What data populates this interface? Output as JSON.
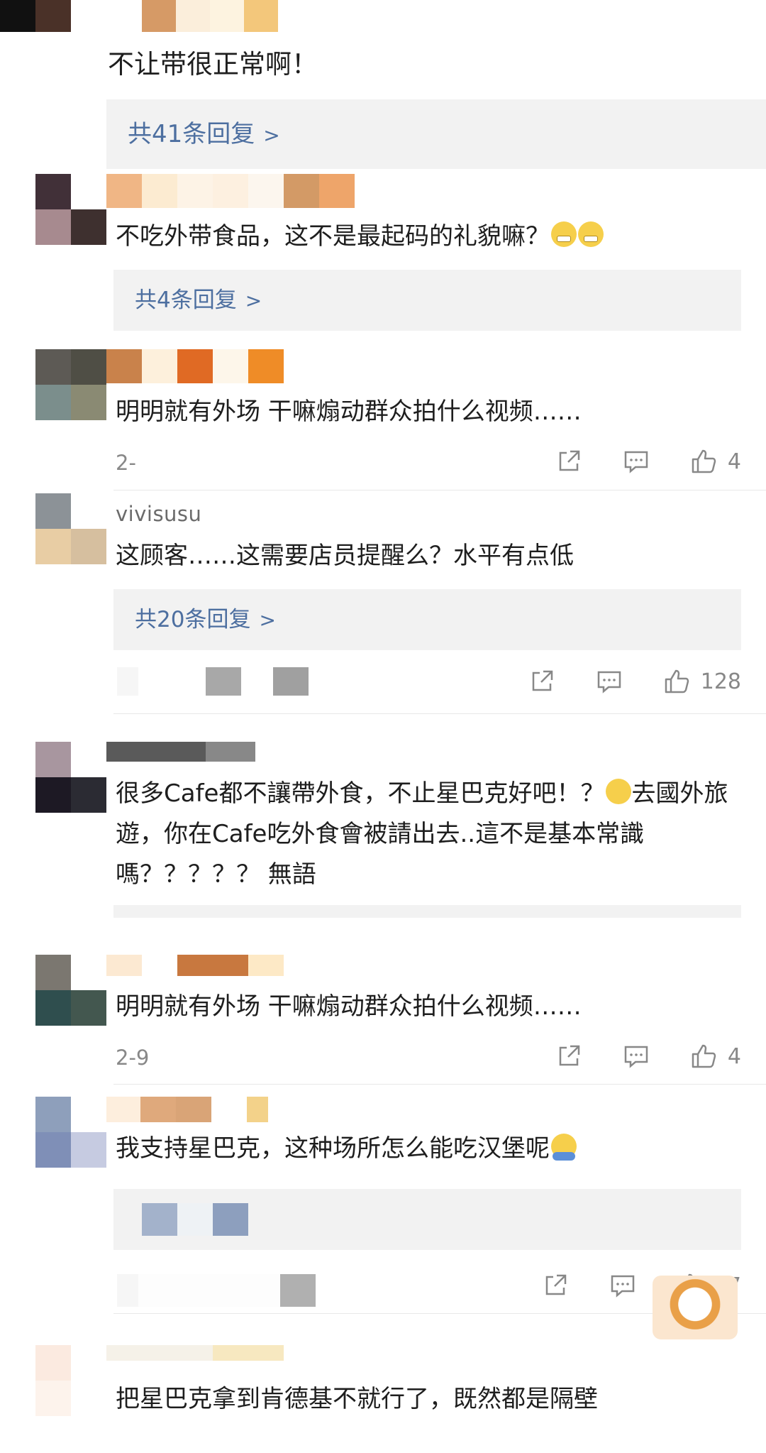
{
  "comments": [
    {
      "text": "不让带很正常啊！",
      "reply": "共41条回复"
    },
    {
      "text": "不吃外带食品，这不是最起码的礼貌嘛？",
      "reply": "共4条回复"
    },
    {
      "text": "明明就有外场 干嘛煽动群众拍什么视频……",
      "date": "2-",
      "likes": "4"
    },
    {
      "username": "vivisusu",
      "text": "这顾客……这需要店员提醒么？水平有点低",
      "reply": "共20条回复",
      "likes": "128"
    },
    {
      "text": "很多Cafe都不讓帶外食，不止星巴克好吧！？",
      "text2": "去國外旅遊，你在Cafe吃外食會被請出去..這不是基本常識嗎？？？？？ 無語"
    },
    {
      "text": "明明就有外场 干嘛煽动群众拍什么视频……",
      "date": "2-9",
      "likes": "4"
    },
    {
      "text": "我支持星巴克，这种场所怎么能吃汉堡呢",
      "likes": "27"
    },
    {
      "text": "把星巴克拿到肯德基不就行了，既然都是隔壁"
    }
  ],
  "icons": {
    "share": "share-icon",
    "comment": "comment-icon",
    "like": "thumbs-up-icon",
    "chevron": "chevron-right-icon"
  },
  "colors": {
    "link": "#4d6fa0",
    "reply_bg": "#f2f2f2",
    "meta": "#888888"
  }
}
